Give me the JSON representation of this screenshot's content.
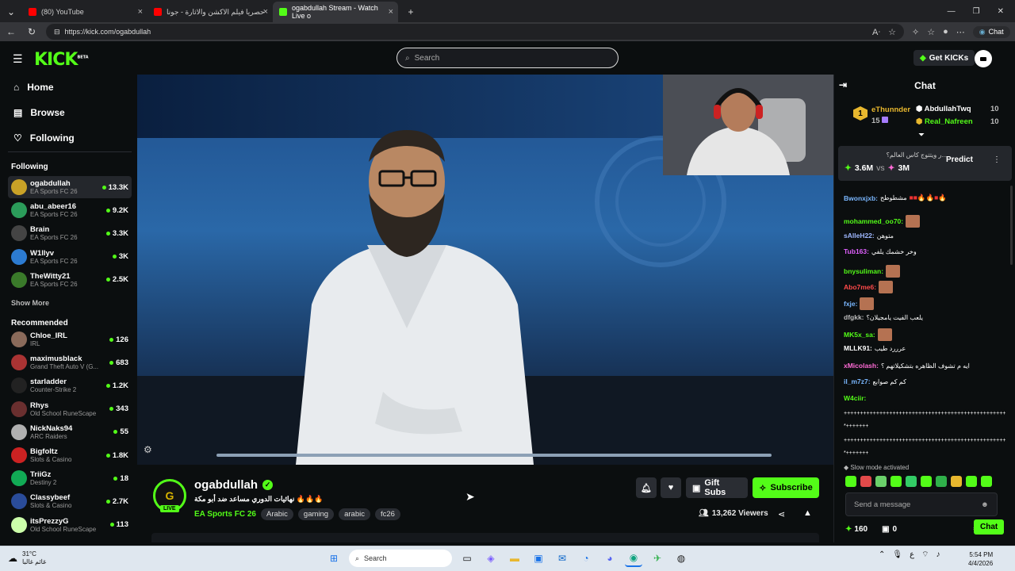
{
  "browser": {
    "tabs": [
      {
        "title": "(80) YouTube",
        "favicon_color": "#ff0000"
      },
      {
        "title": "حصريا فيلم الاكشن والاثارة - جونا",
        "favicon_color": "#ff0000"
      },
      {
        "title": "ogabdullah Stream - Watch Live o",
        "favicon_color": "#53fc18"
      }
    ],
    "url": "https://kick.com/ogabdullah",
    "chat_button": "Chat"
  },
  "header": {
    "logo": "KICK",
    "beta": "BETA",
    "search_placeholder": "Search",
    "get_kicks": "Get KICKs"
  },
  "sidebar": {
    "nav": [
      {
        "label": "Home",
        "icon": "home-icon"
      },
      {
        "label": "Browse",
        "icon": "browse-icon"
      },
      {
        "label": "Following",
        "icon": "heart-icon"
      }
    ],
    "following_title": "Following",
    "following": [
      {
        "name": "ogabdullah",
        "game": "EA Sports FC 26",
        "viewers": "13.3K",
        "color": "#c9a227"
      },
      {
        "name": "abu_abeer16",
        "game": "EA Sports FC 26",
        "viewers": "9.2K",
        "color": "#2b9c5a"
      },
      {
        "name": "Brain",
        "game": "EA Sports FC 26",
        "viewers": "3.3K",
        "color": "#444"
      },
      {
        "name": "W1llyv",
        "game": "EA Sports FC 26",
        "viewers": "3K",
        "color": "#2c7bd1"
      },
      {
        "name": "TheWitty21",
        "game": "EA Sports FC 26",
        "viewers": "2.5K",
        "color": "#3a7a2a"
      }
    ],
    "show_more": "Show More",
    "recommended_title": "Recommended",
    "recommended": [
      {
        "name": "Chloe_IRL",
        "game": "IRL",
        "viewers": "126",
        "color": "#8a6a5a"
      },
      {
        "name": "maximusblack",
        "game": "Grand Theft Auto V (G...",
        "viewers": "683",
        "color": "#a33"
      },
      {
        "name": "starladder",
        "game": "Counter-Strike 2",
        "viewers": "1.2K",
        "color": "#222"
      },
      {
        "name": "Rhys",
        "game": "Old School RuneScape",
        "viewers": "343",
        "color": "#6a2f2f"
      },
      {
        "name": "NickNaks94",
        "game": "ARC Raiders",
        "viewers": "55",
        "color": "#b0b0b0"
      },
      {
        "name": "Bigfoltz",
        "game": "Slots & Casino",
        "viewers": "1.8K",
        "color": "#c22"
      },
      {
        "name": "TriiGz",
        "game": "Destiny 2",
        "viewers": "18",
        "color": "#1a5"
      },
      {
        "name": "Classybeef",
        "game": "Slots & Casino",
        "viewers": "2.7K",
        "color": "#2a4c9a"
      },
      {
        "name": "itsPrezzyG",
        "game": "Old School RuneScape",
        "viewers": "113",
        "color": "#cfa"
      }
    ]
  },
  "stream": {
    "channel": "ogabdullah",
    "live": "LIVE",
    "avatar_letter": "G",
    "title": "🔥🔥🔥 نهائيات الدوري مساعد ضد أبو مكة",
    "category": "EA Sports FC 26",
    "tags": [
      "Arabic",
      "gaming",
      "arabic",
      "fc26"
    ],
    "gift_subs": "Gift Subs",
    "subscribe": "Subscribe",
    "viewers": "13,262 Viewers"
  },
  "chat": {
    "title": "Chat",
    "leaderboard": {
      "rank": "1",
      "top_user": "eThunnder",
      "top_count": "15",
      "second_user": "AbdullahTwq",
      "second_count": "10",
      "third_user": "Real_Nafreen",
      "third_count": "10"
    },
    "prediction": {
      "question": "...ر ويتتوج كاس العالم؟",
      "left_value": "3.6M",
      "vs": "vs",
      "right_value": "3M",
      "button": "Predict"
    },
    "messages": [
      {
        "user": "Bwonxjxb:",
        "text": "مشطوطح",
        "color": "#7ab7ff"
      },
      {
        "user": "mohammed_oo70:",
        "text": "",
        "color": "#53fc18"
      },
      {
        "user": "sAlleH22:",
        "text": "متوهن",
        "color": "#9fb8ff"
      },
      {
        "user": "Tub163:",
        "text": "وخر خشمك يلفي",
        "color": "#e060ff"
      },
      {
        "user": "bnysuliman:",
        "text": "",
        "color": "#53fc18"
      },
      {
        "user": "Abo7me6:",
        "text": "",
        "color": "#ff4a4a"
      },
      {
        "user": "fxje:",
        "text": "",
        "color": "#7ab7ff"
      },
      {
        "user": "dfgkk:",
        "text": "يلعب الفيت يامجيلان؟",
        "color": "#bdbdbd"
      },
      {
        "user": "MK5x_sa:",
        "text": "",
        "color": "#53fc18"
      },
      {
        "user": "MLLK91:",
        "text": "عرررد طيب",
        "color": "#fff"
      },
      {
        "user": "xMicolash:",
        "text": "ايه م تشوف الظاهره بتشكيلاتهم ؟",
        "color": "#ff6bd6"
      },
      {
        "user": "iI_m7z7:",
        "text": "كم كم صوابع",
        "color": "#7ab7ff"
      },
      {
        "user": "W4ciir:",
        "text": "",
        "color": "#53fc18"
      },
      {
        "user": "",
        "text": "++++++++++++++++++++++++++++++++++++++++++++++++++",
        "color": "#fff"
      },
      {
        "user": "",
        "text": "*+++++++",
        "color": "#fff"
      },
      {
        "user": "",
        "text": "++++++++++++++++++++++++++++++++++++++++++++++++++",
        "color": "#fff"
      },
      {
        "user": "",
        "text": "*+++++++",
        "color": "#fff"
      }
    ],
    "slow_mode": "Slow mode activated",
    "input_placeholder": "Send a message",
    "kicks": "160",
    "gifts": "0",
    "send": "Chat"
  },
  "taskbar": {
    "temp": "31°C",
    "weather_text": "غائم غالبا",
    "search": "Search",
    "time": "5:54 PM",
    "date": "4/4/2026",
    "lang": "ع"
  }
}
